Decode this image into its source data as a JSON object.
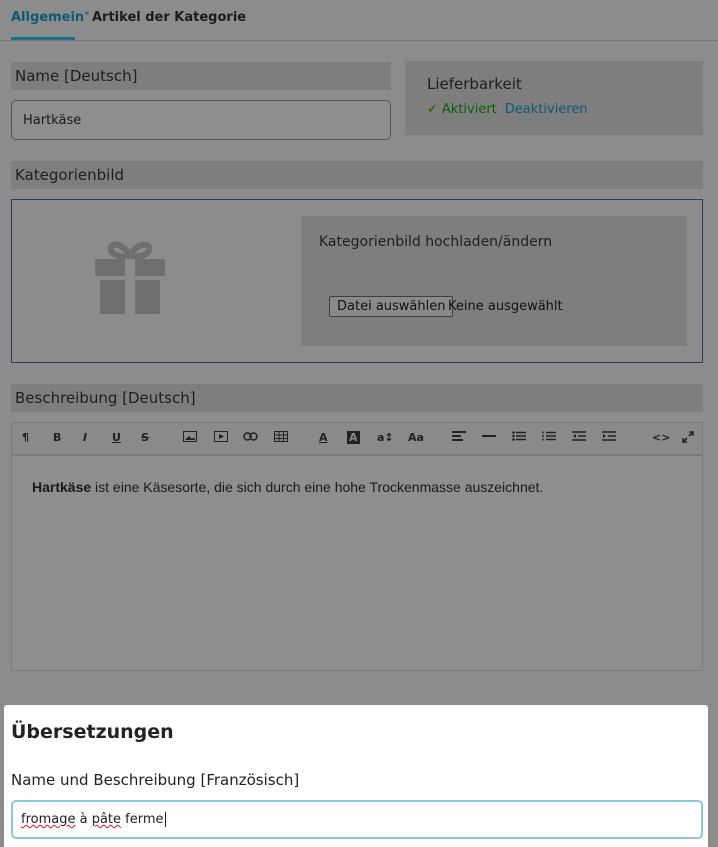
{
  "tabs": [
    {
      "label": "Allgemein",
      "marker": "*",
      "active": true
    },
    {
      "label": "Artikel der Kategorie",
      "active": false
    }
  ],
  "name_section": {
    "header": "Name [Deutsch]",
    "value": "Hartkäse"
  },
  "availability": {
    "title": "Lieferbarkeit",
    "activated_label": "Aktiviert",
    "deactivate_label": "Deaktivieren",
    "check_icon": "check-icon",
    "status_color": "#0d5c0d"
  },
  "image_section": {
    "header": "Kategorienbild",
    "placeholder_icon": "gift-icon",
    "upload_title": "Kategorienbild hochladen/ändern",
    "file_button": "Datei auswählen",
    "file_status": "Keine ausgewählt"
  },
  "description_section": {
    "header": "Beschreibung [Deutsch]",
    "toolbar": [
      {
        "name": "paragraph-icon",
        "glyph": "¶"
      },
      {
        "name": "bold-icon",
        "glyph": "B"
      },
      {
        "name": "italic-icon",
        "glyph": "I"
      },
      {
        "name": "underline-icon",
        "glyph": "U"
      },
      {
        "name": "strikethrough-icon",
        "glyph": "S"
      },
      {
        "name": "image-icon",
        "glyph": "▭"
      },
      {
        "name": "video-icon",
        "glyph": "▶"
      },
      {
        "name": "link-icon",
        "glyph": "⊂⊃"
      },
      {
        "name": "table-icon",
        "glyph": "▦"
      },
      {
        "name": "font-color-icon",
        "glyph": "A"
      },
      {
        "name": "background-color-icon",
        "glyph": "A"
      },
      {
        "name": "font-size-icon",
        "glyph": "a↕"
      },
      {
        "name": "font-family-icon",
        "glyph": "Aa"
      },
      {
        "name": "align-icon",
        "glyph": "≡"
      },
      {
        "name": "horizontal-line-icon",
        "glyph": "—"
      },
      {
        "name": "bullet-list-icon",
        "glyph": "☰"
      },
      {
        "name": "numbered-list-icon",
        "glyph": "☰"
      },
      {
        "name": "outdent-icon",
        "glyph": "⇤"
      },
      {
        "name": "indent-icon",
        "glyph": "⇥"
      },
      {
        "name": "code-view-icon",
        "glyph": "<>"
      },
      {
        "name": "fullscreen-icon",
        "glyph": "⤢"
      }
    ],
    "content_bold": "Hartkäse",
    "content_rest": " ist eine Käsesorte, die sich durch eine hohe Trockenmasse auszeichnet."
  },
  "translations": {
    "title": "Übersetzungen",
    "label": "Name und Beschreibung [Französisch]",
    "value_prefix": "fromage",
    "value_middle": " à ",
    "value_spell": "pâte",
    "value_suffix": " ferme"
  }
}
